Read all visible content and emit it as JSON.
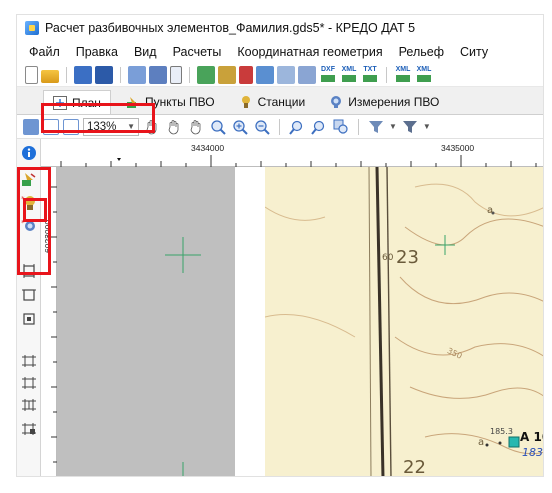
{
  "window": {
    "title": "Расчет разбивочных элементов_Фамилия.gds5* - КРЕДО ДАТ 5"
  },
  "menu": {
    "items": [
      "Файл",
      "Правка",
      "Вид",
      "Расчеты",
      "Координатная геометрия",
      "Рельеф",
      "Ситу"
    ]
  },
  "toolbar": {
    "dxf_label": "DXF",
    "xml_label": "XML",
    "txt_label": "TXT",
    "xml2_label": "XML",
    "xml3_label": "XML",
    "zoom_value": "133%"
  },
  "tabs": [
    {
      "label": "План",
      "icon": "plan-icon",
      "active": true,
      "highlighted": true
    },
    {
      "label": "Пункты ПВО",
      "icon": "points-pvo-icon",
      "active": false
    },
    {
      "label": "Станции",
      "icon": "stations-icon",
      "active": false
    },
    {
      "label": "Измерения ПВО",
      "icon": "measurements-pvo-icon",
      "active": false
    }
  ],
  "rulers": {
    "x_labels": [
      "3434000",
      "3435000"
    ],
    "y_label": "6023000"
  },
  "map": {
    "label_23": "23",
    "label_23_superscript": "60",
    "label_22": "22",
    "label_350": "350",
    "label_185": "185.3",
    "label_a10": "A 10/",
    "label_183": "183,",
    "label_a": "а"
  },
  "left_tools": {
    "icons": [
      "info-icon",
      "points-tool-icon",
      "station-tool-icon",
      "measurement-tool-icon",
      "frame-tool-icon-1",
      "frame-tool-icon-2",
      "frame-tool-icon-3",
      "frame-tool-icon-4",
      "frame-tool-icon-5",
      "frame-tool-icon-6",
      "frame-tool-icon-7"
    ]
  },
  "colors": {
    "highlight": "#e8141b",
    "map_background": "#f7f0cf",
    "gray_area": "#bfbfbf",
    "crosshair": "#3aa36a",
    "info_blue": "#1e6fd9"
  }
}
